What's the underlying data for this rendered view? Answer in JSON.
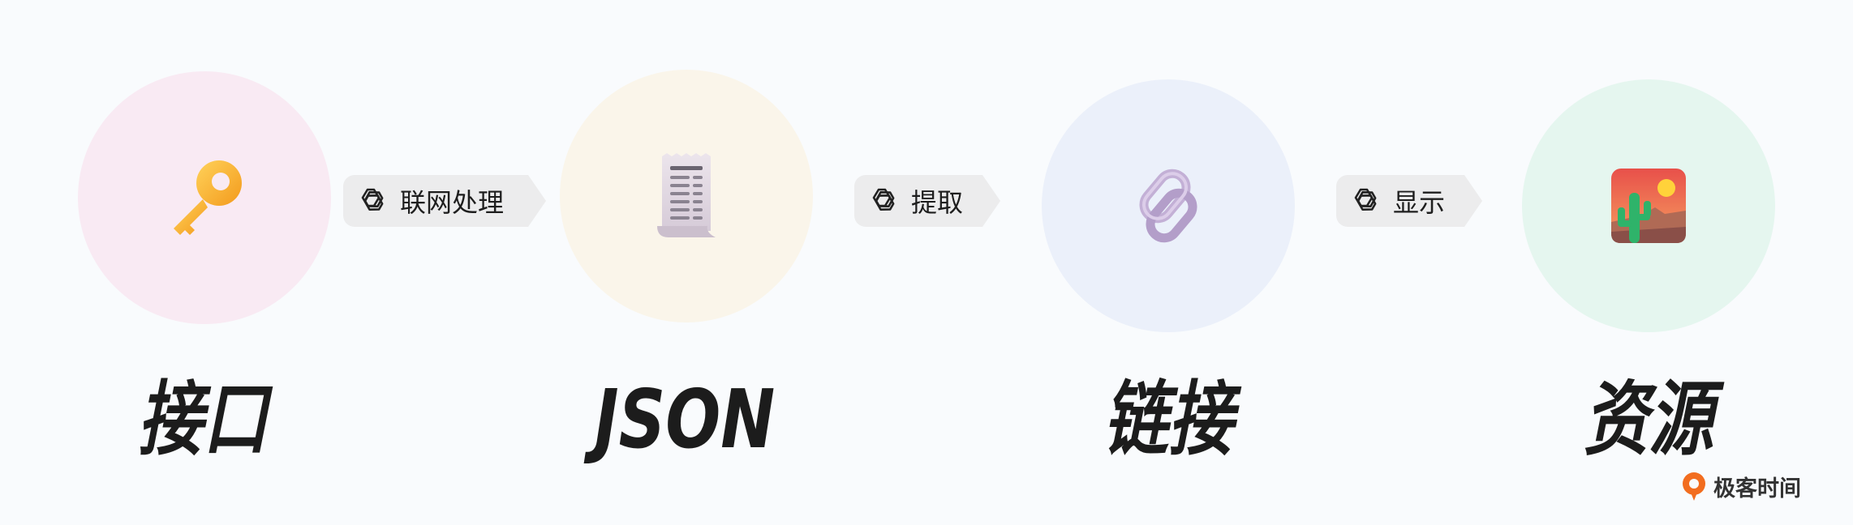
{
  "steps": [
    {
      "label": "接口",
      "icon": "key-icon",
      "color": "#f9eaf3"
    },
    {
      "label": "JSON",
      "icon": "receipt-icon",
      "color": "#faf5ea"
    },
    {
      "label": "链接",
      "icon": "link-icon",
      "color": "#ebf0fa"
    },
    {
      "label": "资源",
      "icon": "picture-icon",
      "color": "#e5f6ef"
    }
  ],
  "arrows": [
    {
      "text": "联网处理",
      "icon": "openai-logo-icon"
    },
    {
      "text": "提取",
      "icon": "openai-logo-icon"
    },
    {
      "text": "显示",
      "icon": "openai-logo-icon"
    }
  ],
  "brand": {
    "text": "极客时间",
    "icon": "geektime-logo-icon",
    "color": "#f26d1f"
  }
}
